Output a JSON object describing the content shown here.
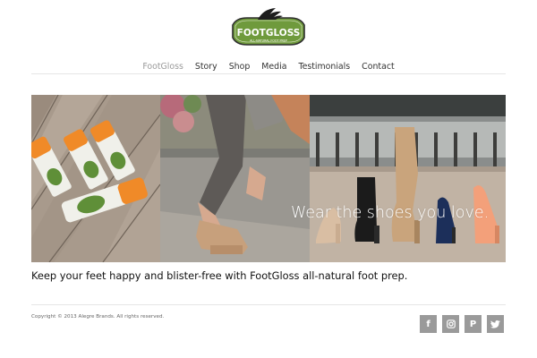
{
  "logo": {
    "brand": "FOOTGLOSS",
    "subtitle": "ALL-NATURAL FOOT PREP",
    "colors": {
      "badge": "#6f9a3c",
      "border": "#2e2e2e",
      "leaf": "#1e1e1e"
    }
  },
  "nav": {
    "items": [
      {
        "label": "FootGloss",
        "active": true
      },
      {
        "label": "Story",
        "active": false
      },
      {
        "label": "Shop",
        "active": false
      },
      {
        "label": "Media",
        "active": false
      },
      {
        "label": "Testimonials",
        "active": false
      },
      {
        "label": "Contact",
        "active": false
      }
    ]
  },
  "hero": {
    "caption": "Wear the shoes you love.",
    "panels": [
      "footgloss-sticks-on-deck",
      "woman-adjusting-wedge-sandal",
      "row-of-shoes-on-pavement"
    ]
  },
  "main": {
    "tagline": "Keep your feet happy and blister-free with FootGloss all-natural foot prep."
  },
  "footer": {
    "copyright": "Copyright © 2013 Alegre Brands. All rights reserved.",
    "social": [
      {
        "icon": "facebook-icon",
        "glyph": "f"
      },
      {
        "icon": "instagram-icon",
        "glyph": ""
      },
      {
        "icon": "pinterest-icon",
        "glyph": "P"
      },
      {
        "icon": "twitter-icon",
        "glyph": ""
      }
    ],
    "social_color": "#9a9a9a"
  }
}
